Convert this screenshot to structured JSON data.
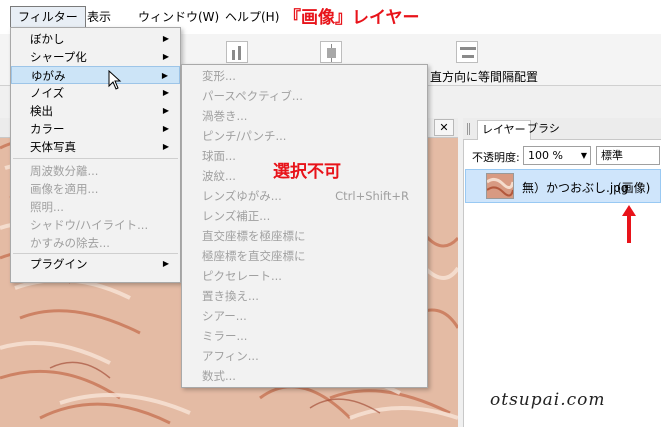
{
  "menubar": {
    "items": [
      {
        "label": "フィルター",
        "name": "menu-filter"
      },
      {
        "label": "表示",
        "name": "menu-view"
      },
      {
        "label": "ウィンドウ(W)",
        "name": "menu-window"
      },
      {
        "label": "ヘルプ(H)",
        "name": "menu-help"
      }
    ]
  },
  "annotation": {
    "title": "『画像』レイヤー",
    "unselectable": "選択不可"
  },
  "toolbar": {
    "distribute_label": "直方向に等間隔配置"
  },
  "filter_menu": {
    "items": [
      {
        "label": "ぼかし",
        "submenu": true,
        "disabled": false
      },
      {
        "label": "シャープ化",
        "submenu": true,
        "disabled": false
      },
      {
        "label": "ゆがみ",
        "submenu": true,
        "disabled": false,
        "highlight": true
      },
      {
        "label": "ノイズ",
        "submenu": true,
        "disabled": false
      },
      {
        "label": "検出",
        "submenu": true,
        "disabled": false
      },
      {
        "label": "カラー",
        "submenu": true,
        "disabled": false
      },
      {
        "label": "天体写真",
        "submenu": true,
        "disabled": false
      },
      {
        "label": "周波数分離...",
        "submenu": false,
        "disabled": true
      },
      {
        "label": "画像を適用...",
        "submenu": false,
        "disabled": true
      },
      {
        "label": "照明...",
        "submenu": false,
        "disabled": true
      },
      {
        "label": "シャドウ/ハイライト...",
        "submenu": false,
        "disabled": true
      },
      {
        "label": "かすみの除去...",
        "submenu": false,
        "disabled": true
      },
      {
        "label": "プラグイン",
        "submenu": true,
        "disabled": false
      }
    ]
  },
  "distort_submenu": {
    "items": [
      {
        "label": "変形...",
        "shortcut": ""
      },
      {
        "label": "パースペクティブ...",
        "shortcut": ""
      },
      {
        "label": "渦巻き...",
        "shortcut": ""
      },
      {
        "label": "ピンチ/パンチ...",
        "shortcut": ""
      },
      {
        "label": "球面...",
        "shortcut": ""
      },
      {
        "label": "波紋...",
        "shortcut": ""
      },
      {
        "label": "レンズゆがみ...",
        "shortcut": "Ctrl+Shift+R"
      },
      {
        "label": "レンズ補正...",
        "shortcut": ""
      },
      {
        "label": "直交座標を極座標に",
        "shortcut": ""
      },
      {
        "label": "極座標を直交座標に",
        "shortcut": ""
      },
      {
        "label": "ピクセレート...",
        "shortcut": ""
      },
      {
        "label": "置き換え...",
        "shortcut": ""
      },
      {
        "label": "シアー...",
        "shortcut": ""
      },
      {
        "label": "ミラー...",
        "shortcut": ""
      },
      {
        "label": "アフィン...",
        "shortcut": ""
      },
      {
        "label": "数式...",
        "shortcut": ""
      }
    ]
  },
  "panel": {
    "tabs": [
      "レイヤー",
      "ブラシ"
    ],
    "opacity_label": "不透明度:",
    "opacity_value": "100 %",
    "blend_mode": "標準",
    "layer_name": "無）かつおぶし.jpg",
    "layer_type": "(画像)"
  },
  "watermark": "otsupai.com",
  "colors": {
    "annotation_red": "#e8131a",
    "highlight_blue": "#cce4f7",
    "layer_selected": "#cfe5fb"
  }
}
